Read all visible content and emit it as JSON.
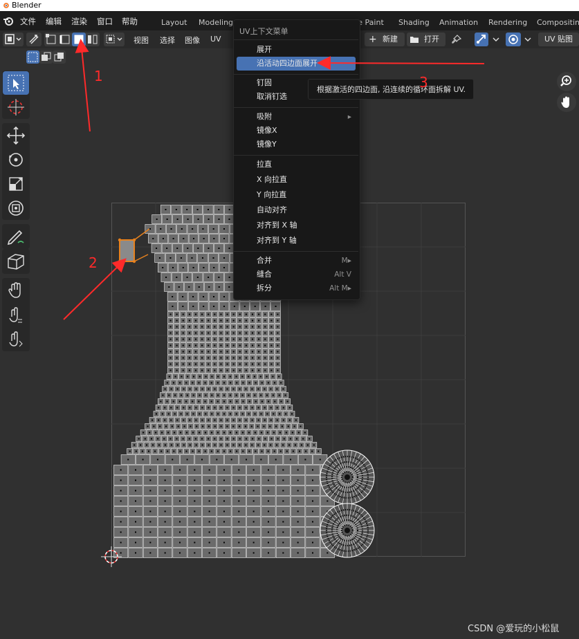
{
  "app": {
    "title": "Blender"
  },
  "menubar": {
    "items": [
      "文件",
      "编辑",
      "渲染",
      "窗口",
      "帮助"
    ],
    "workspaces": [
      "Layout",
      "Modeling",
      "re Paint",
      "Shading",
      "Animation",
      "Rendering",
      "Compositing"
    ]
  },
  "uv_header": {
    "menus": [
      "视图",
      "选择",
      "图像",
      "UV"
    ],
    "new_label": "新建",
    "open_label": "打开",
    "image_label": "UV 贴图",
    "new_plus": "+"
  },
  "context_menu": {
    "title": "UV上下文菜单",
    "groups": [
      [
        {
          "label": "展开",
          "shortcut": ""
        },
        {
          "label": "沿活动四边面展开",
          "shortcut": "",
          "highlighted": true
        }
      ],
      [
        {
          "label": "钉固",
          "shortcut": ""
        },
        {
          "label": "取消钉选",
          "shortcut": ""
        }
      ],
      [
        {
          "label": "吸附",
          "shortcut": "▸"
        },
        {
          "label": "镜像X",
          "shortcut": ""
        },
        {
          "label": "镜像Y",
          "shortcut": ""
        }
      ],
      [
        {
          "label": "拉直",
          "shortcut": ""
        },
        {
          "label": "X 向拉直",
          "shortcut": ""
        },
        {
          "label": "Y 向拉直",
          "shortcut": ""
        },
        {
          "label": "自动对齐",
          "shortcut": ""
        },
        {
          "label": "对齐到 X 轴",
          "shortcut": ""
        },
        {
          "label": "对齐到 Y 轴",
          "shortcut": ""
        }
      ],
      [
        {
          "label": "合并",
          "shortcut": "M▸"
        },
        {
          "label": "缝合",
          "shortcut": "Alt V"
        },
        {
          "label": "拆分",
          "shortcut": "Alt M▸"
        }
      ]
    ]
  },
  "tooltip": {
    "text": "根据激活的四边面, 沿连续的循环面拆解 UV."
  },
  "annotations": {
    "one": "1",
    "two": "2",
    "three": "3"
  },
  "watermark": {
    "text": "CSDN @爱玩的小松鼠"
  },
  "colors": {
    "accent": "#4772b3",
    "arrow": "#ff2a2a",
    "active_face": "#e8821e",
    "mesh_face": "#6b6b6b"
  }
}
